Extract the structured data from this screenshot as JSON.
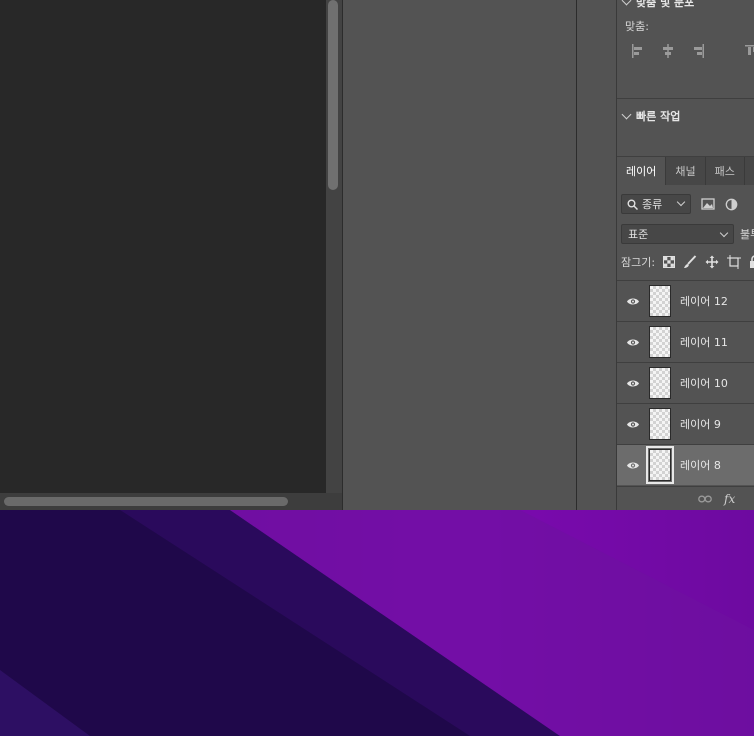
{
  "panels": {
    "align_section": {
      "header": "맞춤 및 분포",
      "align_label": "맞춤:",
      "icons": [
        "align-left-icon",
        "align-horizontal-center-icon",
        "align-right-icon",
        "align-top-icon"
      ]
    },
    "quick_actions": {
      "header": "빠른 작업"
    }
  },
  "layers_panel": {
    "tabs": [
      {
        "label": "레이어",
        "active": true
      },
      {
        "label": "채널",
        "active": false
      },
      {
        "label": "패스",
        "active": false
      }
    ],
    "filter_kind": "종류",
    "blend_mode": "표준",
    "opacity_label": "불투",
    "lock_label": "잠그기:",
    "layers": [
      {
        "name": "레이어 12",
        "visible": true,
        "selected": false
      },
      {
        "name": "레이어 11",
        "visible": true,
        "selected": false
      },
      {
        "name": "레이어 10",
        "visible": true,
        "selected": false
      },
      {
        "name": "레이어 9",
        "visible": true,
        "selected": false
      },
      {
        "name": "레이어 8",
        "visible": true,
        "selected": true
      }
    ],
    "bottom_fx": "fx"
  },
  "colors": {
    "panel_bg": "#535353",
    "canvas_bg": "#282828",
    "selected_row": "#6c6c6c",
    "wallpaper_purple": "#7a0aa8",
    "wallpaper_dark": "#1e0c4a"
  }
}
